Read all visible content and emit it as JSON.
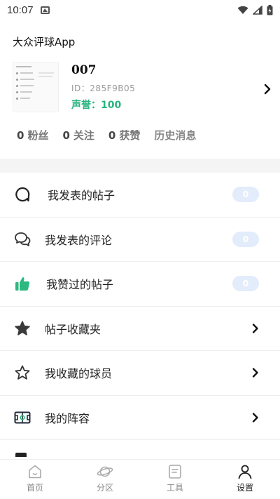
{
  "status_bar": {
    "time": "10:07"
  },
  "app_title": "大众评球App",
  "profile": {
    "username": "007",
    "user_id": "ID：285F9B05",
    "reputation": "声誉：100"
  },
  "stats": {
    "fans": {
      "count": "0",
      "label": "粉丝"
    },
    "following": {
      "count": "0",
      "label": "关注"
    },
    "likes": {
      "count": "0",
      "label": "获赞"
    },
    "history_label": "历史消息"
  },
  "menu": {
    "items": [
      {
        "label": "我发表的帖子",
        "icon": "chat-bubble-icon",
        "badge": "0"
      },
      {
        "label": "我发表的评论",
        "icon": "comments-icon",
        "badge": "0"
      },
      {
        "label": "我赞过的帖子",
        "icon": "thumbs-up-icon",
        "badge": "0"
      },
      {
        "label": "帖子收藏夹",
        "icon": "star-filled-icon"
      },
      {
        "label": "我收藏的球员",
        "icon": "star-outline-icon"
      },
      {
        "label": "我的阵容",
        "icon": "lineup-icon"
      }
    ]
  },
  "tabbar": {
    "tabs": [
      {
        "label": "首页",
        "icon": "home-icon"
      },
      {
        "label": "分区",
        "icon": "planet-icon"
      },
      {
        "label": "工具",
        "icon": "document-icon"
      },
      {
        "label": "设置",
        "icon": "user-icon",
        "active": true
      }
    ]
  },
  "colors": {
    "accent_green": "#27b37f",
    "badge_bg": "#e3ecfb",
    "divider": "#f4f4f4"
  }
}
